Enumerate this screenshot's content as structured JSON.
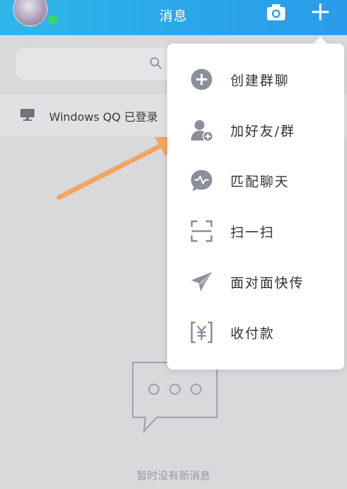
{
  "header": {
    "title": "消息"
  },
  "login_banner": {
    "text": "Windows QQ 已登录"
  },
  "menu": {
    "items": [
      {
        "label": "创建群聊",
        "icon": "add-circle-icon"
      },
      {
        "label": "加好友/群",
        "icon": "add-friend-icon"
      },
      {
        "label": "匹配聊天",
        "icon": "match-chat-icon"
      },
      {
        "label": "扫一扫",
        "icon": "scan-icon"
      },
      {
        "label": "面对面快传",
        "icon": "paper-plane-icon"
      },
      {
        "label": "收付款",
        "icon": "payment-icon"
      }
    ]
  },
  "empty_state": {
    "text": "暂时没有新消息"
  },
  "colors": {
    "header": "#2aa6ea",
    "icon": "#8a8f99",
    "annotation_arrow": "#f3a564"
  }
}
